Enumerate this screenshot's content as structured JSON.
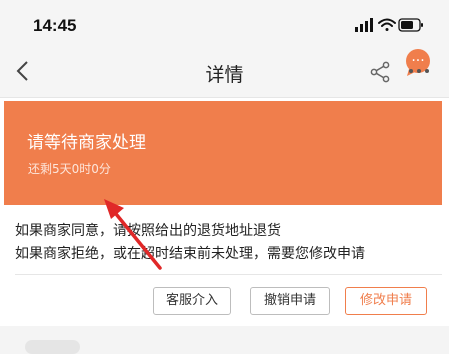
{
  "status_bar": {
    "time": "14:45"
  },
  "nav": {
    "title": "详情",
    "badge": "···"
  },
  "status_card": {
    "title": "请等待商家处理",
    "remaining": "还剩5天0时0分"
  },
  "info": {
    "line1": "如果商家同意，请按照给出的退货地址退货",
    "line2": "如果商家拒绝，或在超时结束前未处理，需要您修改申请"
  },
  "actions": {
    "service": "客服介入",
    "cancel": "撤销申请",
    "modify": "修改申请"
  },
  "colors": {
    "accent": "#f07e4c",
    "arrow": "#e02828"
  },
  "icons": [
    "signal-icon",
    "wifi-icon",
    "battery-icon",
    "back-icon",
    "share-icon",
    "more-icon"
  ]
}
